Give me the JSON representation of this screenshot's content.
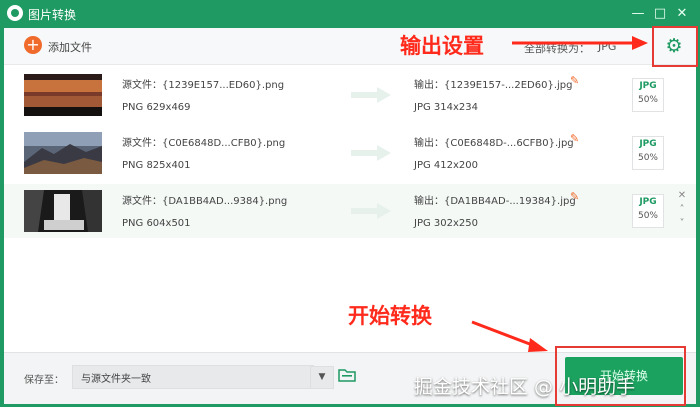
{
  "window": {
    "title": "图片转换"
  },
  "toolbar": {
    "add_label": "添加文件",
    "format_label": "全部转换为：",
    "format_value": "JPG"
  },
  "files": [
    {
      "source_name": "源文件：{1239E157...ED60}.png",
      "source_info": "PNG  629x469",
      "output_name": "输出：{1239E157-...2ED60}.jpg",
      "output_info": "JPG  314x234",
      "badge_format": "JPG",
      "quality": "50%"
    },
    {
      "source_name": "源文件：{C0E6848D...CFB0}.png",
      "source_info": "PNG  825x401",
      "output_name": "输出：{C0E6848D-...6CFB0}.jpg",
      "output_info": "JPG  412x200",
      "badge_format": "JPG",
      "quality": "50%"
    },
    {
      "source_name": "源文件：{DA1BB4AD...9384}.png",
      "source_info": "PNG  604x501",
      "output_name": "输出：{DA1BB4AD-...19384}.jpg",
      "output_info": "JPG  302x250",
      "badge_format": "JPG",
      "quality": "50%"
    }
  ],
  "footer": {
    "save_label": "保存至：",
    "save_value": "与源文件夹一致",
    "start_label": "开始转换"
  },
  "annotations": {
    "settings_callout": "输出设置",
    "start_callout": "开始转换"
  },
  "watermark": "掘金技术社区 @ 小明助手",
  "icons": [
    "app-icon",
    "plus-icon",
    "gear-icon",
    "arrow-right-icon",
    "edit-icon",
    "close-icon",
    "chevron-up-icon",
    "chevron-down-icon",
    "caret-down-icon",
    "folder-icon"
  ],
  "colors": {
    "brand": "#1e9a62",
    "accent": "#f06a2b",
    "annotation": "#ff2a1b"
  }
}
